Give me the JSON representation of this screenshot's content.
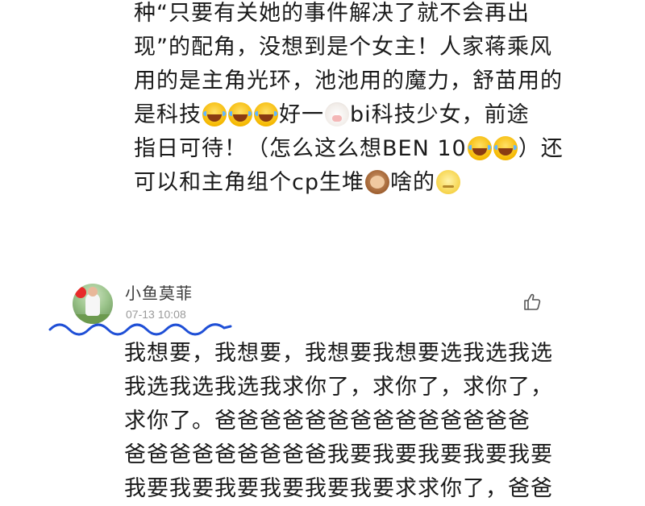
{
  "previous_comment": {
    "segments": [
      [
        "种“只要有关她的事件解决了就不会再出"
      ],
      [
        "现”的配角，没想到是个女主！人家蒋乘风"
      ],
      [
        "用的是主角光环，池池用的魔力，舒苗用的"
      ],
      [
        "是科技",
        {
          "emoji": "laugh"
        },
        {
          "emoji": "laugh"
        },
        {
          "emoji": "laugh"
        },
        "好一",
        {
          "emoji": "cow"
        },
        "bi科技少女，前途"
      ],
      [
        "指日可待！（怎么这么想BEN 10",
        {
          "emoji": "laugh"
        },
        {
          "emoji": "laugh"
        },
        "）还"
      ],
      [
        "可以和主角组个cp生堆",
        {
          "emoji": "monkey"
        },
        "啥的",
        {
          "emoji": "moon"
        }
      ]
    ],
    "text_line_1": "种“只要有关她的事件解决了就不会再出",
    "text_line_2": "现”的配角，没想到是个女主！人家蒋乘风",
    "text_line_3": "用的是主角光环，池池用的魔力，舒苗用的",
    "text_line_4a": "是科技",
    "text_line_4b": "好一",
    "text_line_4c": "bi科技少女，前途",
    "text_line_5a": "指日可待！（怎么这么想BEN 10",
    "text_line_5b": "）还",
    "text_line_6a": "可以和主角组个cp生堆",
    "text_line_6b": "啥的"
  },
  "comment": {
    "user_name": "小鱼莫菲",
    "timestamp": "07-13 10:08",
    "like_icon": "thumbs-up-icon",
    "annotation_color": "#1f4fd6",
    "body_lines": [
      "我想要，我想要，我想要我想要选我选我选",
      "我选我选我选我求你了，求你了，求你了，",
      "求你了。爸爸爸爸爸爸爸爸爸爸爸爸爸爸",
      "爸爸爸爸爸爸爸爸爸我要我要我要我要我要",
      "我要我要我要我要我要我要求求你了，爸爸"
    ]
  }
}
